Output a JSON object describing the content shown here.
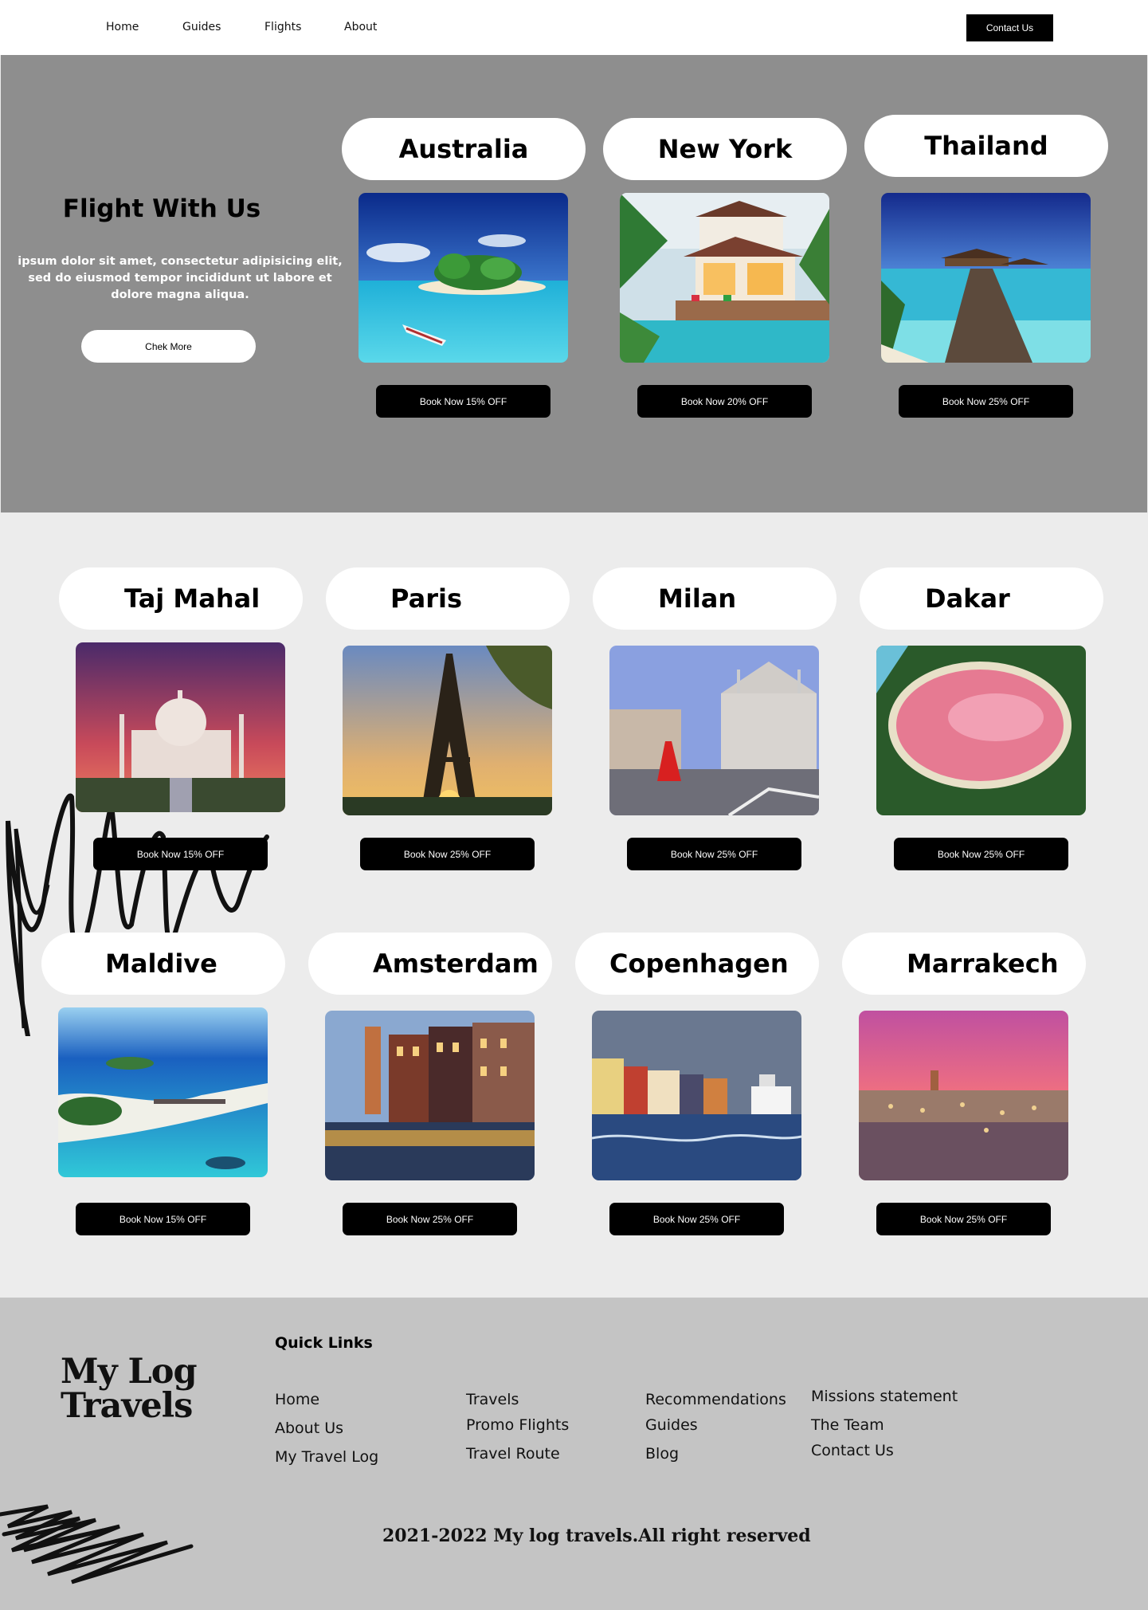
{
  "nav": {
    "links": [
      "Home",
      "Guides",
      "Flights",
      "About"
    ],
    "contact_label": "Contact Us"
  },
  "hero": {
    "title": "Flight With Us",
    "text": "ipsum dolor sit amet, consectetur adipisicing elit, sed do eiusmod tempor incididunt ut labore et dolore magna aliqua.",
    "button_label": "Chek More"
  },
  "featured": [
    {
      "name": "Australia",
      "button": "Book Now 15% OFF",
      "image": "tropical-island-photo"
    },
    {
      "name": "New York",
      "button": "Book Now 20% OFF",
      "image": "villa-pool-photo"
    },
    {
      "name": "Thailand",
      "button": "Book Now 25% OFF",
      "image": "overwater-bungalow-photo"
    }
  ],
  "destinations": [
    {
      "name": "Taj Mahal",
      "button": "Book Now 15% OFF",
      "image": "taj-mahal-photo"
    },
    {
      "name": "Paris",
      "button": "Book Now 25% OFF",
      "image": "eiffel-tower-photo"
    },
    {
      "name": "Milan",
      "button": "Book Now 25% OFF",
      "image": "milan-cathedral-photo"
    },
    {
      "name": "Dakar",
      "button": "Book Now 25% OFF",
      "image": "pink-lake-photo"
    },
    {
      "name": "Maldive",
      "button": "Book Now 15% OFF",
      "image": "maldives-aerial-photo"
    },
    {
      "name": "Amsterdam",
      "button": "Book Now 25% OFF",
      "image": "amsterdam-canal-photo"
    },
    {
      "name": "Copenhagen",
      "button": "Book Now 25% OFF",
      "image": "copenhagen-harbor-photo"
    },
    {
      "name": "Marrakech",
      "button": "Book Now 25% OFF",
      "image": "marrakech-square-photo"
    }
  ],
  "footer": {
    "logo_line1": "My Log",
    "logo_line2": "Travels",
    "quick_links_title": "Quick Links",
    "col1": [
      "Home",
      "About Us",
      "My Travel Log"
    ],
    "col2": [
      "Travels",
      "Promo Flights",
      "Travel Route"
    ],
    "col3": [
      "Recommendations",
      "Guides",
      "Blog"
    ],
    "col4": [
      "Missions statement",
      "The Team",
      "Contact Us"
    ],
    "copyright": "2021-2022 My log travels.All right reserved"
  }
}
